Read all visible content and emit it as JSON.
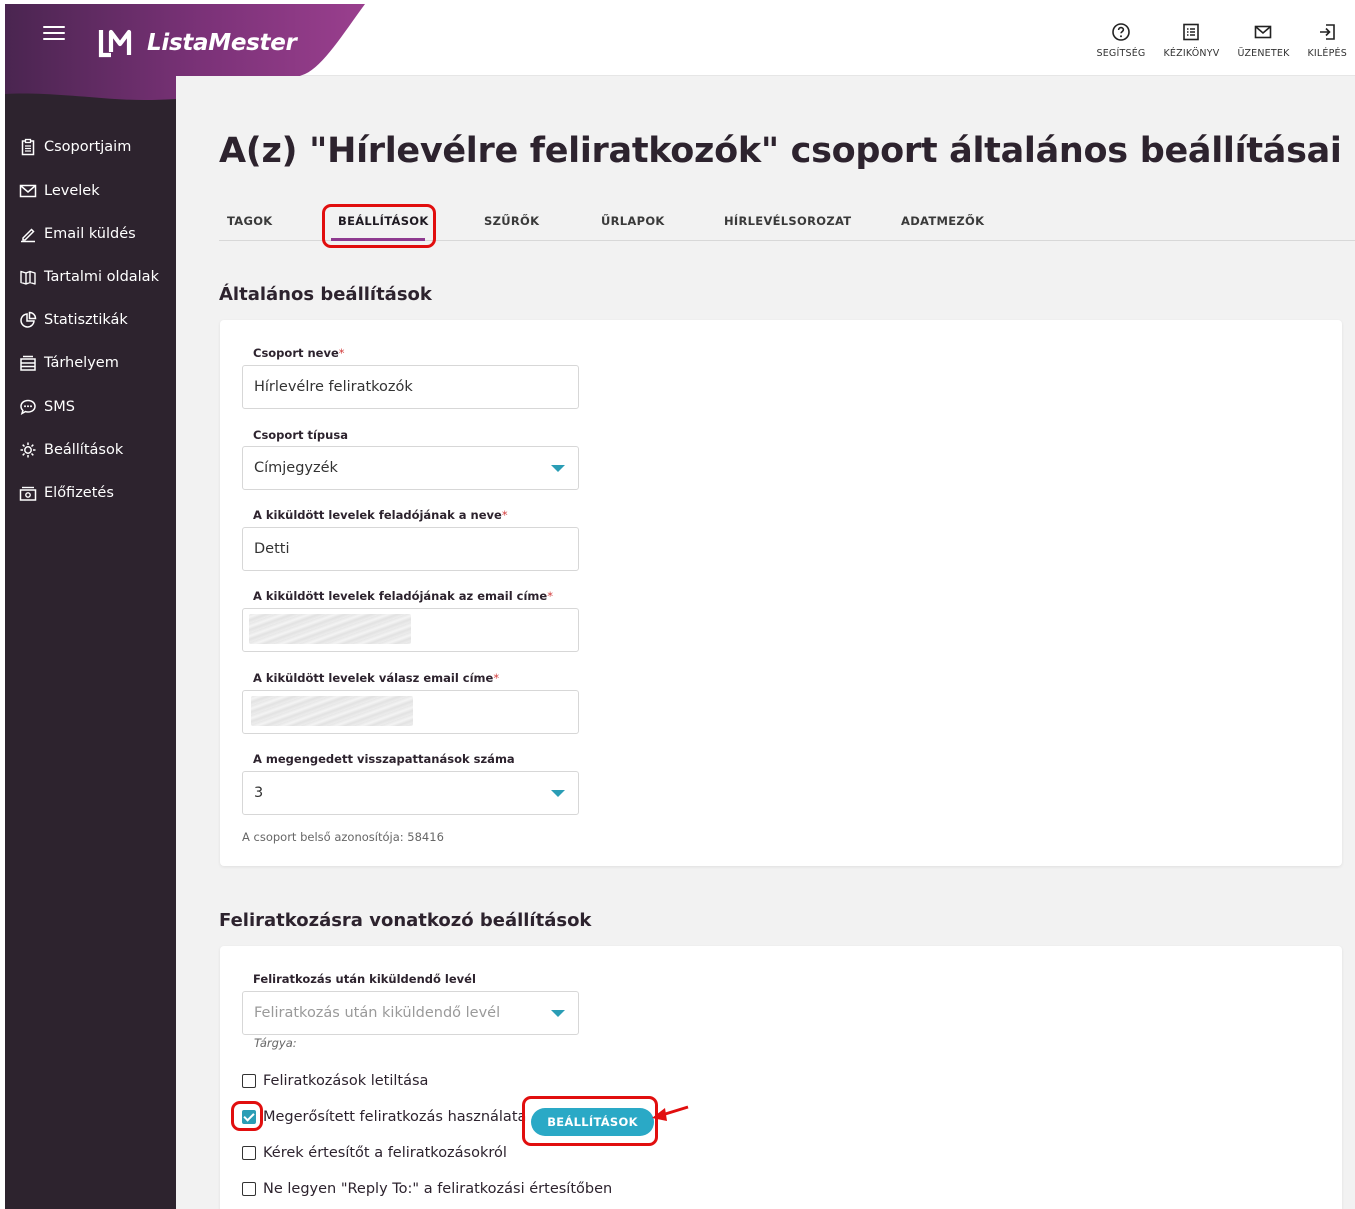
{
  "header": {
    "brand_name": "ListaMester",
    "actions": [
      {
        "label": "SEGÍTSÉG",
        "icon": "help-circle-icon"
      },
      {
        "label": "KÉZIKÖNYV",
        "icon": "manual-icon"
      },
      {
        "label": "ÜZENETEK",
        "icon": "mail-icon"
      },
      {
        "label": "KILÉPÉS",
        "icon": "logout-icon"
      }
    ]
  },
  "sidebar": {
    "items": [
      {
        "label": "Csoportjaim",
        "icon": "clipboard-icon"
      },
      {
        "label": "Levelek",
        "icon": "envelope-icon"
      },
      {
        "label": "Email küldés",
        "icon": "pencil-icon"
      },
      {
        "label": "Tartalmi oldalak",
        "icon": "book-icon"
      },
      {
        "label": "Statisztikák",
        "icon": "pie-chart-icon"
      },
      {
        "label": "Tárhelyem",
        "icon": "storage-icon"
      },
      {
        "label": "SMS",
        "icon": "chat-bubble-icon"
      },
      {
        "label": "Beállítások",
        "icon": "gear-icon"
      },
      {
        "label": "Előfizetés",
        "icon": "money-icon"
      }
    ]
  },
  "main": {
    "title": "A(z) \"Hírlevélre feliratkozók\" csoport általános beállításai",
    "tabs": [
      {
        "label": "TAGOK"
      },
      {
        "label": "BEÁLLÍTÁSOK",
        "active": true
      },
      {
        "label": "SZŰRŐK"
      },
      {
        "label": "ŰRLAPOK"
      },
      {
        "label": "HÍRLEVÉLSOROZAT"
      },
      {
        "label": "ADATMEZŐK"
      }
    ],
    "general": {
      "section_title": "Általános beállítások",
      "group_name_label": "Csoport neve",
      "group_name_value": "Hírlevélre feliratkozók",
      "group_type_label": "Csoport típusa",
      "group_type_value": "Címjegyzék",
      "sender_name_label": "A kiküldött levelek feladójának a neve",
      "sender_name_value": "Detti",
      "sender_email_label": "A kiküldött levelek feladójának az email címe",
      "reply_email_label": "A kiküldött levelek válasz email címe",
      "bounces_label": "A megengedett visszapattanások száma",
      "bounces_value": "3",
      "required_mark": "*",
      "group_id_text": "A csoport belső azonosítója: 58416"
    },
    "subscription": {
      "section_title": "Feliratkozásra vonatkozó beállítások",
      "after_sub_label": "Feliratkozás után kiküldendő levél",
      "after_sub_placeholder": "Feliratkozás után kiküldendő levél",
      "subject_hint": "Tárgya:",
      "checkboxes": [
        {
          "label": "Feliratkozások letiltása",
          "checked": false
        },
        {
          "label": "Megerősített feliratkozás használata",
          "checked": true
        },
        {
          "label": "Kérek értesítőt a feliratkozásokról",
          "checked": false
        },
        {
          "label": "Ne legyen \"Reply To:\" a feliratkozási értesítőben",
          "checked": false
        }
      ],
      "settings_button": "BEÁLLÍTÁSOK"
    }
  },
  "colors": {
    "sidebar_bg": "#2d232e",
    "brand_purple": "#8e3a8f",
    "accent_teal": "#2aa9c6",
    "highlight_red": "#e10e0e"
  }
}
